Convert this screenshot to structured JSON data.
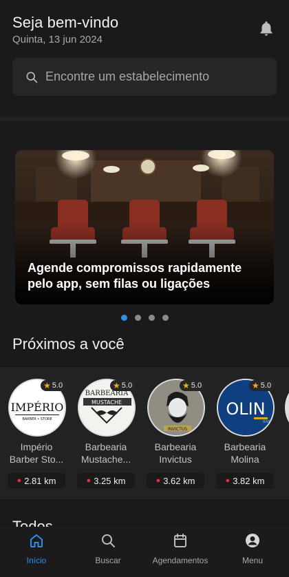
{
  "header": {
    "title": "Seja bem-vindo",
    "date": "Quinta, 13 jun 2024"
  },
  "search": {
    "placeholder": "Encontre um estabelecimento"
  },
  "banner": {
    "line1": "Agende compromissos rapidamente",
    "line2": "pelo app, sem filas ou ligações",
    "dots_total": 4,
    "active_dot": 0
  },
  "nearby": {
    "title": "Próximos a você",
    "shops": [
      {
        "name1": "Império",
        "name2": "Barber Sto...",
        "rating": "5.0",
        "distance": "2.81 km",
        "logo_text": "IMPÉRIO",
        "logo_sub": "BARBER • STORE"
      },
      {
        "name1": "Barbearia",
        "name2": "Mustache...",
        "rating": "5.0",
        "distance": "3.25 km",
        "logo_text": "BARBEARIA",
        "logo_sub": "MUSTACHE"
      },
      {
        "name1": "Barbearia",
        "name2": "Invictus",
        "rating": "5.0",
        "distance": "3.62 km",
        "logo_text": "INVICTUS",
        "logo_sub": ""
      },
      {
        "name1": "Barbearia",
        "name2": "Molina",
        "rating": "5.0",
        "distance": "3.82 km",
        "logo_text": "OLIN",
        "logo_sub": "BARB"
      }
    ]
  },
  "all_section": {
    "title": "Todos"
  },
  "tabbar": {
    "tabs": [
      {
        "label": "Início",
        "active": true
      },
      {
        "label": "Buscar",
        "active": false
      },
      {
        "label": "Agendamentos",
        "active": false
      },
      {
        "label": "Menu",
        "active": false
      }
    ]
  },
  "colors": {
    "accent": "#2f8ee8",
    "background": "#1a1a1a",
    "star": "#f2b01e",
    "pin": "#e0333d"
  }
}
